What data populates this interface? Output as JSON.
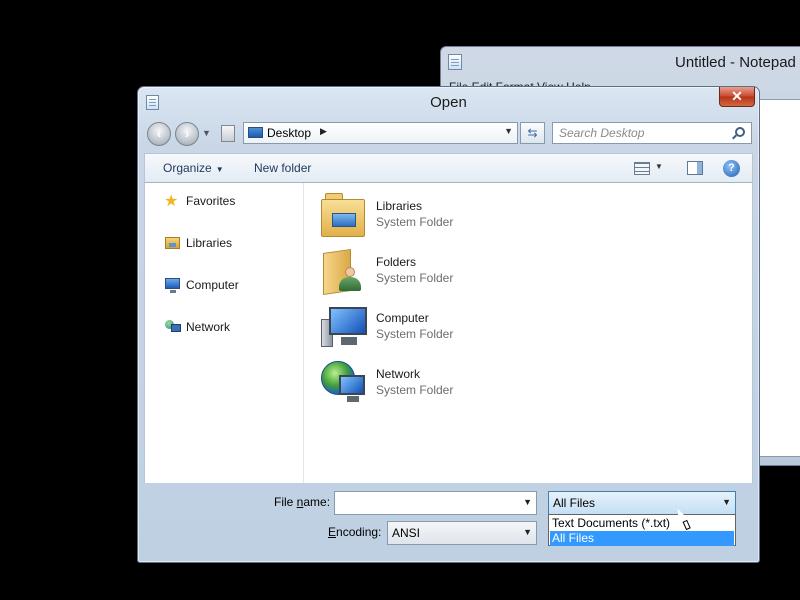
{
  "notepad": {
    "title": "Untitled - Notepad",
    "menu": "File  Edit  Format  View  Help"
  },
  "dialog": {
    "title": "Open",
    "close_symbol": "✕",
    "address": {
      "location": "Desktop",
      "crumb_arrow": "▶",
      "dropdown_arrow": "▼"
    },
    "refresh_symbol": "⇆",
    "search": {
      "placeholder": "Search Desktop"
    },
    "toolbar": {
      "organize": "Organize",
      "organize_arrow": "▼",
      "new_folder": "New folder",
      "views_arrow": "▼",
      "help_symbol": "?"
    },
    "navigation": [
      {
        "label": "Favorites",
        "icon": "star-icon"
      },
      {
        "label": "Libraries",
        "icon": "libraries-icon"
      },
      {
        "label": "Computer",
        "icon": "computer-icon"
      },
      {
        "label": "Network",
        "icon": "network-icon"
      }
    ],
    "items": [
      {
        "name": "Libraries",
        "type": "System Folder",
        "icon": "libraries-icon"
      },
      {
        "name": "Folders",
        "type": "System Folder",
        "icon": "user-folder-icon"
      },
      {
        "name": "Computer",
        "type": "System Folder",
        "icon": "computer-icon"
      },
      {
        "name": "Network",
        "type": "System Folder",
        "icon": "network-icon"
      }
    ],
    "file_name": {
      "label_pre": "File ",
      "label_underline": "n",
      "label_post": "ame:",
      "value": "",
      "dropdown_arrow": "▼"
    },
    "encoding": {
      "label_underline": "E",
      "label_post": "ncoding:",
      "value": "ANSI",
      "dropdown_arrow": "▼"
    },
    "file_type": {
      "selected": "All Files",
      "dropdown_arrow": "▼",
      "options": [
        "Text Documents (*.txt)",
        "All Files"
      ],
      "highlighted_option": "All Files"
    }
  },
  "colors": {
    "selection": "#3399ff",
    "close_button": "#c8462d",
    "link_text": "#1e395b"
  }
}
